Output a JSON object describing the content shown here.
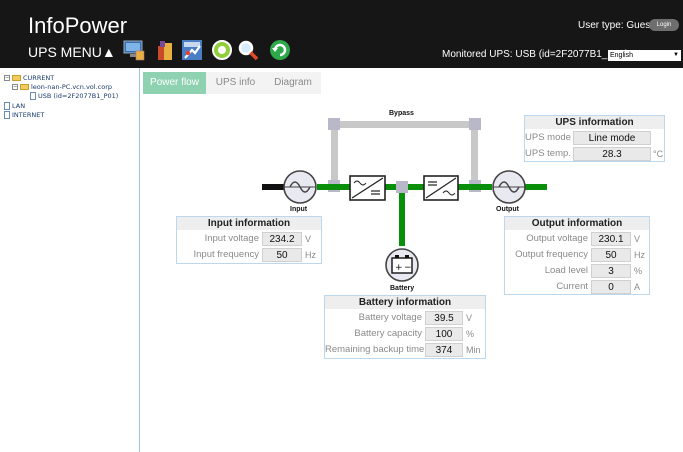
{
  "header": {
    "app_title": "InfoPower",
    "ups_menu_label": "UPS MENU▲",
    "user_type": "User type: Guest",
    "login_label": "Login",
    "monitored": "Monitored UPS: USB (id=2F2077B1_P01)",
    "language": "English",
    "toolbar_icons": [
      "monitor-icon",
      "battery-test-icon",
      "settings-icon",
      "event-log-icon",
      "search-icon",
      "refresh-icon"
    ]
  },
  "sidebar": {
    "tree": [
      {
        "label": "CURRENT",
        "icon": "folder-icon"
      },
      {
        "label": "leon-nan-PC.vcn.vol.corp",
        "icon": "folder-icon"
      },
      {
        "label": "USB (id=2F2077B1_P01)",
        "icon": "document-icon"
      },
      {
        "label": "LAN",
        "icon": "document-icon"
      },
      {
        "label": "INTERNET",
        "icon": "document-icon"
      }
    ]
  },
  "tabs": [
    {
      "label": "Power flow",
      "active": true
    },
    {
      "label": "UPS info",
      "active": false
    },
    {
      "label": "Diagram",
      "active": false
    }
  ],
  "diagram": {
    "bypass_label": "Bypass",
    "input_label": "Input",
    "output_label": "Output",
    "battery_label": "Battery",
    "colors": {
      "active_line": "#0a8f0a",
      "inactive_line": "#c8c8c8",
      "black_line": "#111111"
    }
  },
  "ups_info": {
    "title": "UPS information",
    "rows": [
      {
        "label": "UPS mode",
        "value": "Line mode",
        "unit": ""
      },
      {
        "label": "UPS temp.",
        "value": "28.3",
        "unit": "°C"
      }
    ]
  },
  "input_info": {
    "title": "Input information",
    "rows": [
      {
        "label": "Input voltage",
        "value": "234.2",
        "unit": "V"
      },
      {
        "label": "Input frequency",
        "value": "50",
        "unit": "Hz"
      }
    ]
  },
  "output_info": {
    "title": "Output information",
    "rows": [
      {
        "label": "Output voltage",
        "value": "230.1",
        "unit": "V"
      },
      {
        "label": "Output frequency",
        "value": "50",
        "unit": "Hz"
      },
      {
        "label": "Load level",
        "value": "3",
        "unit": "%"
      },
      {
        "label": "Current",
        "value": "0",
        "unit": "A"
      }
    ]
  },
  "battery_info": {
    "title": "Battery information",
    "rows": [
      {
        "label": "Battery voltage",
        "value": "39.5",
        "unit": "V"
      },
      {
        "label": "Battery capacity",
        "value": "100",
        "unit": "%"
      },
      {
        "label": "Remaining backup time",
        "value": "374",
        "unit": "Min"
      }
    ]
  }
}
